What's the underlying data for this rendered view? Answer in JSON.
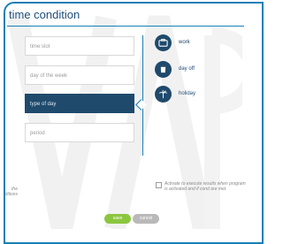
{
  "panel": {
    "title": "time condition"
  },
  "fields": [
    {
      "label": "time slot"
    },
    {
      "label": "day of the week"
    },
    {
      "label": "type of day"
    },
    {
      "label": "period"
    }
  ],
  "options": [
    {
      "label": "work",
      "icon": "briefcase-icon"
    },
    {
      "label": "day off",
      "icon": "cup-icon"
    },
    {
      "label": "holiday",
      "icon": "palm-icon"
    }
  ],
  "activation": {
    "text": "Activate to execute results when program is activated and if cond are met."
  },
  "left_note": {
    "text": "the ditions"
  },
  "buttons": {
    "save": "save",
    "cancel": "cancel"
  },
  "colors": {
    "accent": "#1a7fb5",
    "active": "#1f4a6c",
    "save": "#8cc63f",
    "cancel": "#b9b9b9"
  }
}
